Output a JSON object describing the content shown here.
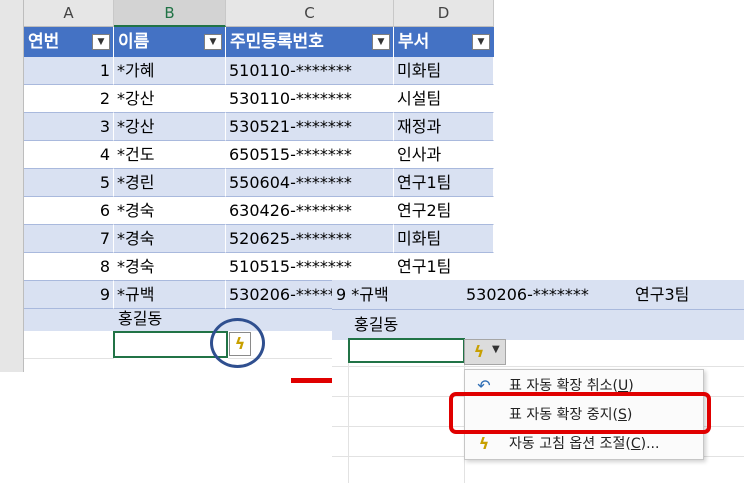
{
  "columns": [
    "A",
    "B",
    "C",
    "D"
  ],
  "table": {
    "headers": [
      "연번",
      "이름",
      "주민등록번호",
      "부서"
    ],
    "rows": [
      {
        "no": "1",
        "name": "*가혜",
        "id": "510110-*******",
        "dept": "미화팀"
      },
      {
        "no": "2",
        "name": "*강산",
        "id": "530110-*******",
        "dept": "시설팀"
      },
      {
        "no": "3",
        "name": "*강산",
        "id": "530521-*******",
        "dept": "재정과"
      },
      {
        "no": "4",
        "name": "*건도",
        "id": "650515-*******",
        "dept": "인사과"
      },
      {
        "no": "5",
        "name": "*경린",
        "id": "550604-*******",
        "dept": "연구1팀"
      },
      {
        "no": "6",
        "name": "*경숙",
        "id": "630426-*******",
        "dept": "연구2팀"
      },
      {
        "no": "7",
        "name": "*경숙",
        "id": "520625-*******",
        "dept": "미화팀"
      },
      {
        "no": "8",
        "name": "*경숙",
        "id": "510515-*******",
        "dept": "연구1팀"
      },
      {
        "no": "9",
        "name": "*규백",
        "id": "530206-*****",
        "dept": ""
      }
    ],
    "extra_name": "홍길동"
  },
  "zoom": {
    "row9_prefix": "9 *규백",
    "row9_id": "530206-*******",
    "row9_dept": "연구3팀",
    "extra_name": "홍길동"
  },
  "menu": {
    "items": [
      {
        "label": "표 자동 확장 취소",
        "key": "U",
        "icon": "undo-arrow"
      },
      {
        "label": "표 자동 확장 중지",
        "key": "S",
        "icon": ""
      },
      {
        "label": "자동 고침 옵션 조절",
        "key": "C",
        "suffix": "...",
        "icon": "autocorrect-lightning"
      }
    ]
  },
  "colors": {
    "header_blue": "#4472c4",
    "band_light": "#d9e1f2",
    "selection_green": "#217346",
    "annotation_red": "#e00000",
    "circle_navy": "#2f4f8f"
  }
}
